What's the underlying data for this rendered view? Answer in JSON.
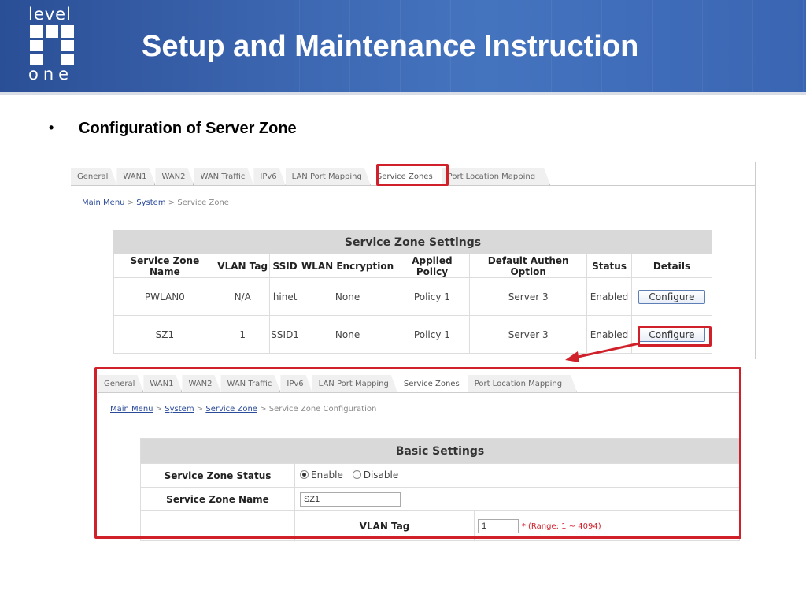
{
  "slide": {
    "title": "Setup and Maintenance Instruction",
    "bullet": "Configuration of Server Zone",
    "logo_top": "level",
    "logo_bottom": "one",
    "accent_red": "#d0202a",
    "header_blue": "#3a63ad"
  },
  "top_panel": {
    "tabs": [
      "General",
      "WAN1",
      "WAN2",
      "WAN Traffic",
      "IPv6",
      "LAN Port Mapping",
      "Service Zones",
      "Port Location Mapping"
    ],
    "active_tab": "Service Zones",
    "breadcrumb": {
      "link1": "Main Menu",
      "sep": ">",
      "link2": "System",
      "current": "Service Zone"
    },
    "table": {
      "caption": "Service Zone Settings",
      "headers": [
        "Service Zone Name",
        "VLAN Tag",
        "SSID",
        "WLAN Encryption",
        "Applied Policy",
        "Default Authen Option",
        "Status",
        "Details"
      ],
      "rows": [
        {
          "name": "PWLAN0",
          "vlan": "N/A",
          "ssid": "hinet",
          "enc": "None",
          "policy": "Policy 1",
          "auth": "Server 3",
          "status": "Enabled",
          "action": "Configure"
        },
        {
          "name": "SZ1",
          "vlan": "1",
          "ssid": "SSID1",
          "enc": "None",
          "policy": "Policy 1",
          "auth": "Server 3",
          "status": "Enabled",
          "action": "Configure"
        }
      ]
    }
  },
  "bottom_panel": {
    "tabs": [
      "General",
      "WAN1",
      "WAN2",
      "WAN Traffic",
      "IPv6",
      "LAN Port Mapping",
      "Service Zones",
      "Port Location Mapping"
    ],
    "active_tab": "Service Zones",
    "breadcrumb": {
      "link1": "Main Menu",
      "link2": "System",
      "link3": "Service Zone",
      "current": "Service Zone Configuration",
      "sep": ">"
    },
    "basic": {
      "title": "Basic Settings",
      "status_label": "Service Zone Status",
      "enable": "Enable",
      "disable": "Disable",
      "selected": "Enable",
      "name_label": "Service Zone Name",
      "name_value": "SZ1",
      "vlan_label": "VLAN Tag",
      "vlan_value": "1",
      "vlan_hint": "* (Range: 1 ~ 4094)"
    }
  }
}
